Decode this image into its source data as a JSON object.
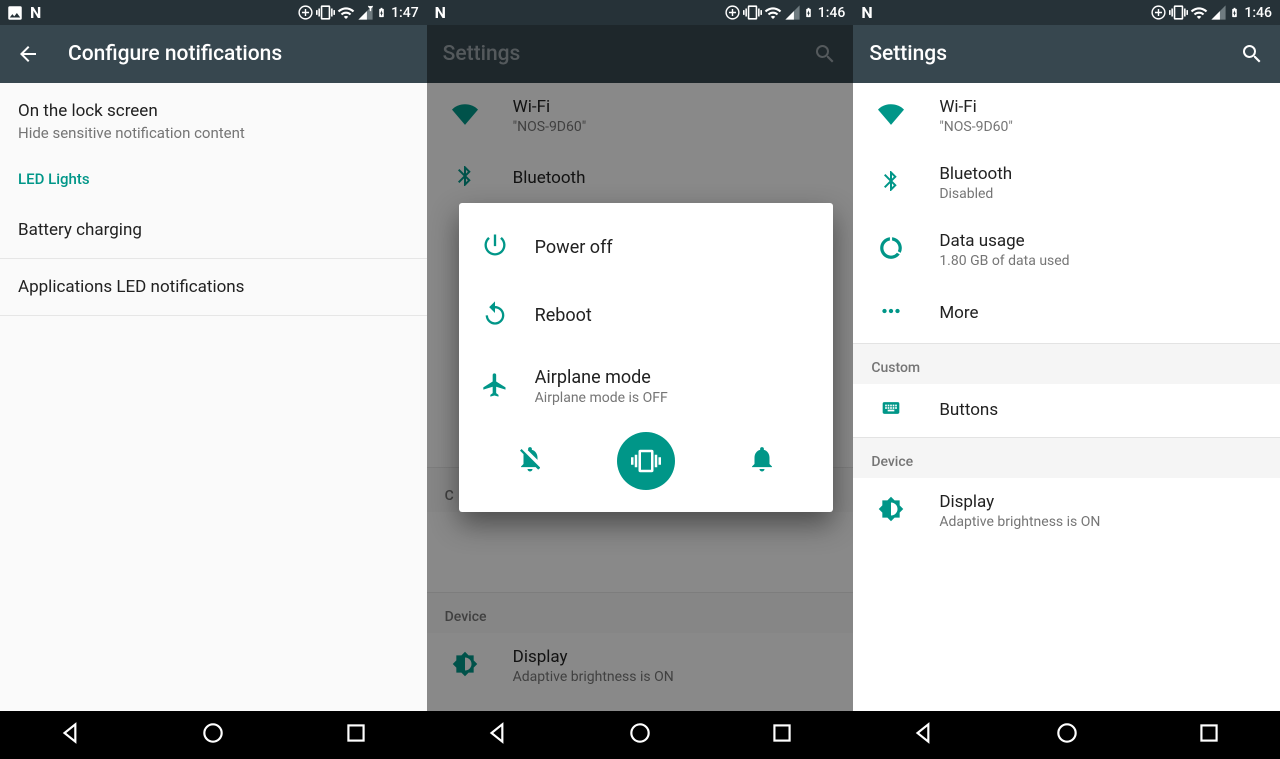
{
  "colors": {
    "teal": "#009688",
    "toolbar": "#37474f",
    "status": "#263238"
  },
  "screenA": {
    "time": "1:47",
    "title": "Configure notifications",
    "lock_title": "On the lock screen",
    "lock_sub": "Hide sensitive notification content",
    "led_header": "LED Lights",
    "battery": "Battery charging",
    "apps_led": "Applications LED notifications"
  },
  "screenB": {
    "time": "1:46",
    "title": "Settings",
    "wifi_title": "Wi-Fi",
    "wifi_sub": "\"NOS-9D60\"",
    "bt_title": "Bluetooth",
    "custom": "C",
    "device_label": "Device",
    "display_title": "Display",
    "display_sub": "Adaptive brightness is ON",
    "power_off": "Power off",
    "reboot": "Reboot",
    "airplane_title": "Airplane mode",
    "airplane_sub": "Airplane mode is OFF"
  },
  "screenC": {
    "time": "1:46",
    "title": "Settings",
    "wifi_title": "Wi-Fi",
    "wifi_sub": "\"NOS-9D60\"",
    "bt_title": "Bluetooth",
    "bt_sub": "Disabled",
    "data_title": "Data usage",
    "data_sub": "1.80 GB of data used",
    "more": "More",
    "custom_label": "Custom",
    "buttons": "Buttons",
    "device_label": "Device",
    "display_title": "Display",
    "display_sub": "Adaptive brightness is ON"
  }
}
